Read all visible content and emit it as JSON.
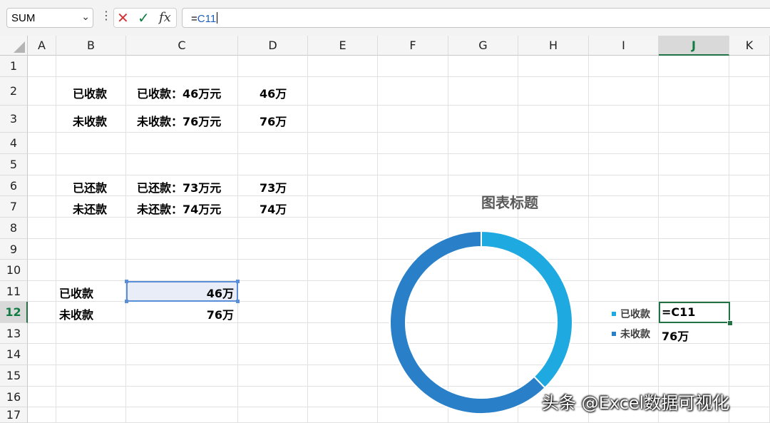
{
  "formula_bar": {
    "name_box": "SUM",
    "formula_prefix": "=",
    "formula_ref": "C11"
  },
  "icons": {
    "cancel": "✕",
    "enter": "✓",
    "insert_function": "fx",
    "name_box_dropdown": "⌄",
    "more_options": "⋮"
  },
  "columns": [
    "A",
    "B",
    "C",
    "D",
    "E",
    "F",
    "G",
    "H",
    "I",
    "J",
    "K"
  ],
  "rows": [
    "1",
    "2",
    "3",
    "4",
    "5",
    "6",
    "7",
    "8",
    "9",
    "10",
    "11",
    "12",
    "13",
    "14",
    "15",
    "16",
    "17"
  ],
  "cells": {
    "B2": "已收款",
    "C2": "已收款：46万元",
    "D2": "46万",
    "B3": "未收款",
    "C3": "未收款：76万元",
    "D3": "76万",
    "B6": "已还款",
    "C6": "已还款：73万元",
    "D6": "73万",
    "B7": "未还款",
    "C7": "未还款：74万元",
    "D7": "74万",
    "B11": "已收款",
    "C11": "46万",
    "B12": "未收款",
    "C12": "76万",
    "J12": "=C11",
    "J13": "76万"
  },
  "chart_data": {
    "type": "pie",
    "variant": "doughnut",
    "title": "图表标题",
    "categories": [
      "已收款",
      "未收款"
    ],
    "values": [
      46,
      76
    ],
    "colors": [
      "#1ea9e1",
      "#2980c8"
    ],
    "legend": "right"
  },
  "watermark": "头条 @Excel数据可视化",
  "colors": {
    "accent": "#217346",
    "selection": "#5b8ed8"
  }
}
